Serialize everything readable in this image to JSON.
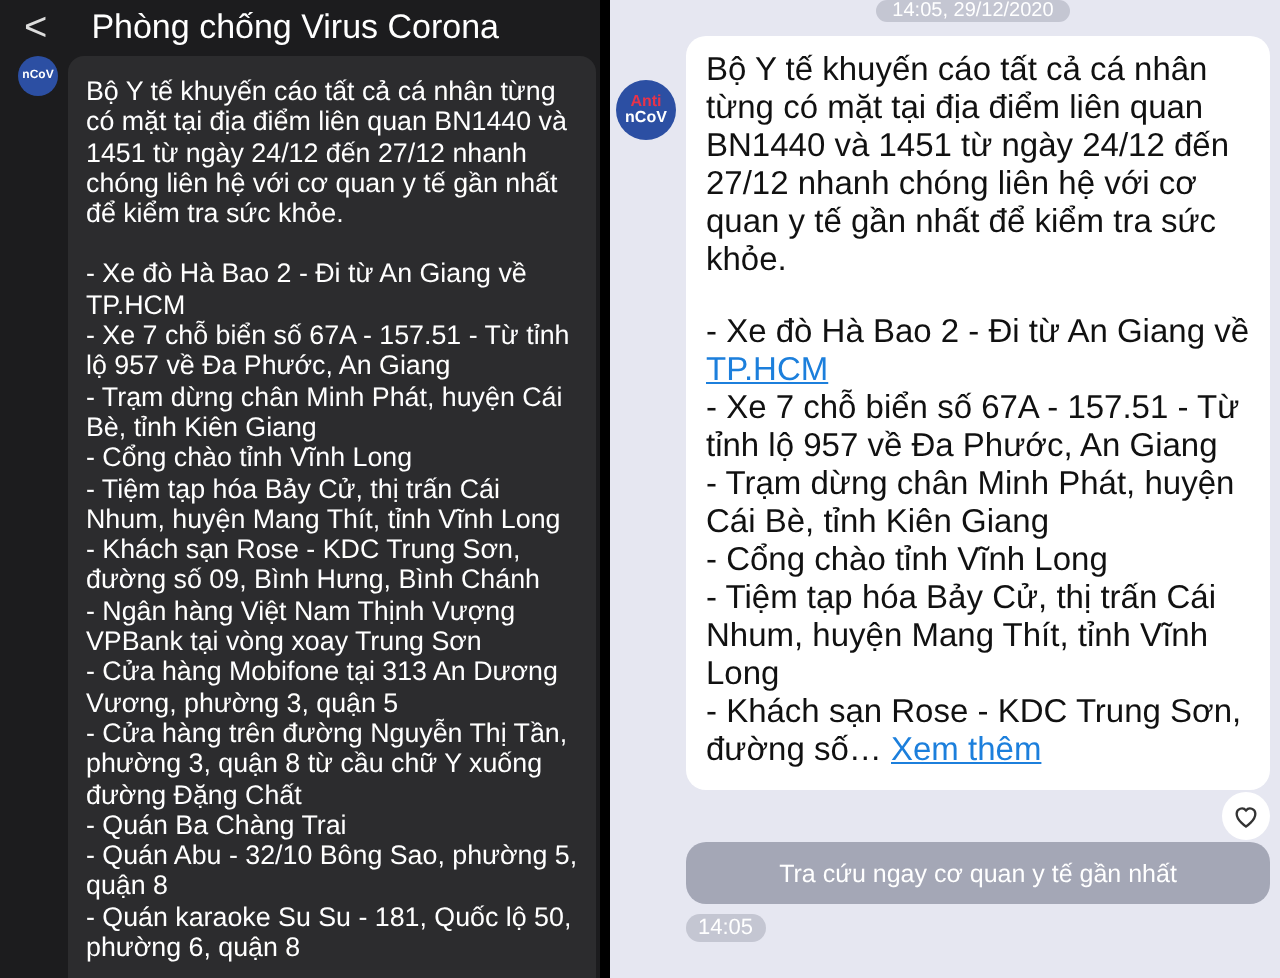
{
  "left_screen": {
    "header": {
      "back": "<",
      "title": "Phòng chống Virus Corona"
    },
    "avatar": {
      "lines": [
        "nCoV"
      ]
    },
    "message": {
      "intro": "Bộ Y tế khuyến cáo tất cả cá nhân từng có mặt tại địa điểm liên quan BN1440 và 1451 từ ngày 24/12 đến 27/12 nhanh chóng liên hệ với cơ quan y tế gần nhất để kiểm tra sức khỏe.",
      "items": [
        "- Xe đò Hà Bao 2 - Đi từ An Giang về TP.HCM",
        "- Xe 7 chỗ biển số 67A - 157.51 - Từ tỉnh lộ 957 về Đa Phước, An Giang",
        "- Trạm dừng chân Minh Phát, huyện Cái Bè, tỉnh Kiên Giang",
        "- Cổng chào tỉnh Vĩnh Long",
        "- Tiệm tạp hóa Bảy Cử, thị trấn Cái Nhum, huyện Mang Thít, tỉnh Vĩnh Long",
        "- Khách sạn Rose - KDC Trung Sơn, đường số 09, Bình Hưng, Bình Chánh",
        "- Ngân hàng Việt Nam Thịnh Vượng VPBank tại vòng xoay Trung Sơn",
        "- Cửa hàng Mobifone tại 313 An Dương Vương, phường 3, quận 5",
        "- Cửa hàng trên đường Nguyễn Thị Tần, phường 3, quận 8 từ cầu chữ Y xuống đường Đặng Chất",
        "- Quán Ba Chàng Trai",
        "- Quán Abu - 32/10 Bông Sao, phường 5, quận 8",
        "- Quán karaoke Su Su - 181, Quốc lộ 50, phường 6, quận 8"
      ]
    }
  },
  "right_screen": {
    "date_stamp": "14:05, 29/12/2020",
    "avatar": {
      "lines": [
        "Anti",
        "nCoV"
      ]
    },
    "message": {
      "intro": "Bộ Y tế khuyến cáo tất cả cá nhân từng có mặt tại địa điểm liên quan BN1440 và 1451 từ ngày 24/12 đến 27/12 nhanh chóng liên hệ với cơ quan y tế gần nhất để kiểm tra sức khỏe.",
      "items": [
        {
          "text": "- Xe đò Hà Bao 2 - Đi từ An Giang về ",
          "link": "TP.HCM"
        },
        {
          "text": "- Xe 7 chỗ biển số 67A - 157.51 - Từ tỉnh lộ 957 về Đa Phước, An Giang"
        },
        {
          "text": "- Trạm dừng chân Minh Phát, huyện Cái Bè, tỉnh Kiên Giang"
        },
        {
          "text": "- Cổng chào tỉnh Vĩnh Long"
        },
        {
          "text": "- Tiệm tạp hóa Bảy Cử, thị trấn Cái Nhum, huyện Mang Thít, tỉnh Vĩnh Long"
        },
        {
          "text": "- Khách sạn Rose - KDC Trung Sơn, đường số… ",
          "link": "Xem thêm"
        }
      ]
    },
    "liked": false,
    "action_button": "Tra cứu ngay cơ quan y tế gần nhất",
    "time": "14:05"
  }
}
